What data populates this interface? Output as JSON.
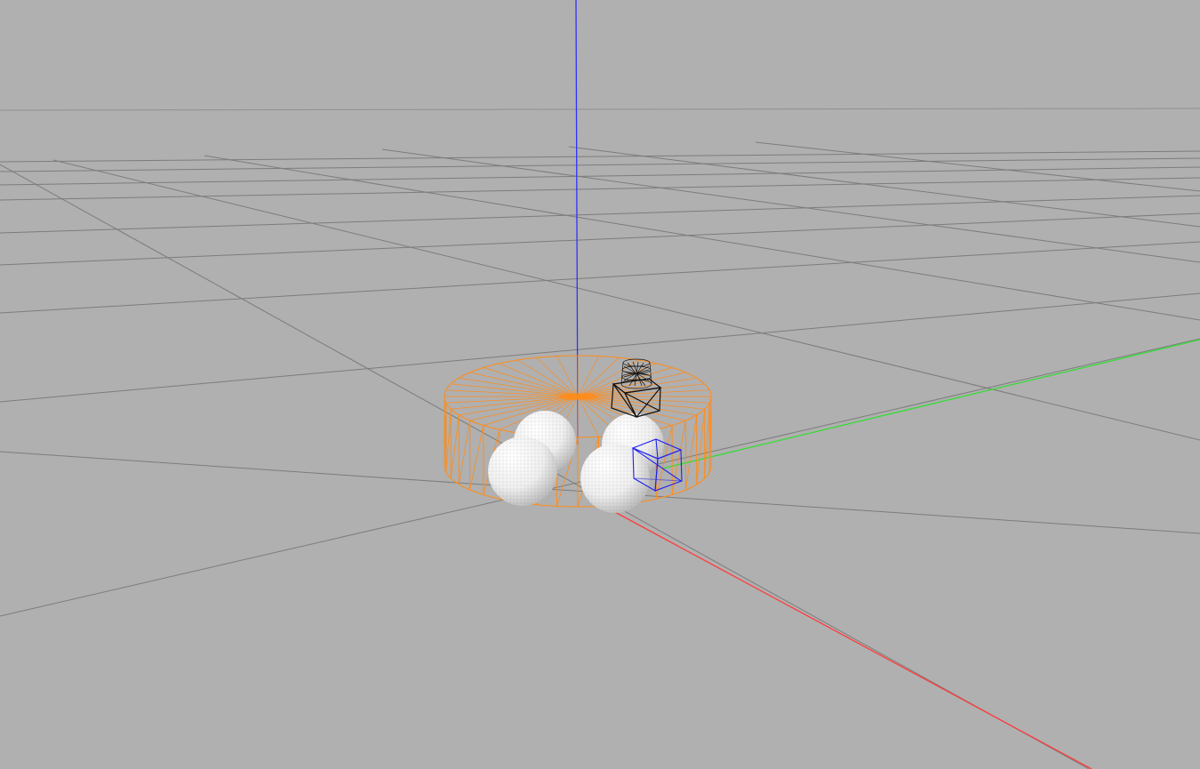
{
  "viewport": {
    "background_color": "#b0b0b0",
    "grid_color": "#7c7c7c",
    "axis_colors": {
      "x": "#ff3b3b",
      "y": "#33dd33",
      "z": "#3030ff"
    }
  },
  "scene": {
    "objects": [
      {
        "name": "cylinder-wireframe",
        "color": "#ff8c1a"
      },
      {
        "name": "sphere",
        "count": 4,
        "color": "#f4f4f4"
      },
      {
        "name": "camera-sensor",
        "color": "#111111"
      },
      {
        "name": "selected-cube",
        "color": "#2020ee"
      }
    ]
  }
}
